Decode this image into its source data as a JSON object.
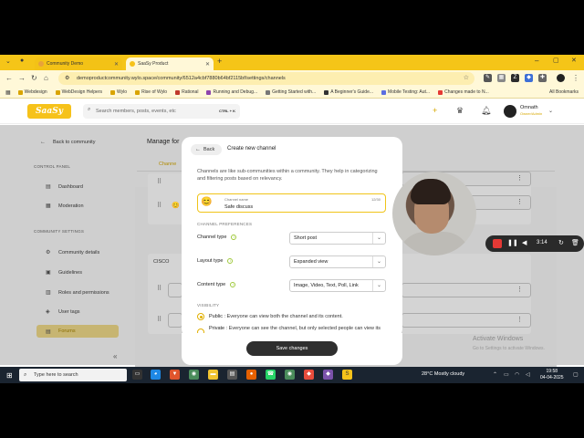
{
  "browser": {
    "tabs": [
      {
        "label": "Community Demo",
        "color": "#e8a23a"
      },
      {
        "label": "SaaSy Product",
        "color": "#f6c21a"
      }
    ],
    "url": "demoproductcommunity.wylo.space/community/6512a4cbf7880b64bf2115bf/settings/channels",
    "bookmarks": [
      "Webdesign",
      "WebDesign Helpers",
      "Wylo",
      "Rise of Wylo",
      "Rational",
      "Running and Debug...",
      "Getting Started with...",
      "A Beginner's Guide...",
      "Mobile Testing: Aut...",
      "Changes made to N..."
    ],
    "all_bookmarks": "All Bookmarks"
  },
  "app": {
    "logo": "SaaSy",
    "search_placeholder": "Search members, posts, events, etc",
    "search_shortcut": "CTRL + K",
    "user_name": "Omnath",
    "user_role": "Owner/Admin"
  },
  "sidebar": {
    "back": "Back to community",
    "control_panel": "CONTROL PANEL",
    "items_control": [
      {
        "label": "Dashboard",
        "icon": "dashboard-icon"
      },
      {
        "label": "Moderation",
        "icon": "moderation-icon"
      }
    ],
    "community_settings": "COMMUNITY SETTINGS",
    "items_settings": [
      {
        "label": "Community details",
        "icon": "details-icon"
      },
      {
        "label": "Guidelines",
        "icon": "guidelines-icon"
      },
      {
        "label": "Roles and permissions",
        "icon": "roles-icon"
      },
      {
        "label": "User tags",
        "icon": "tag-icon"
      },
      {
        "label": "Forums",
        "icon": "forum-icon"
      }
    ]
  },
  "main": {
    "title": "Manage for",
    "tab": "Channe",
    "group": "CISCO"
  },
  "modal": {
    "back": "Back",
    "title": "Create new channel",
    "description": "Channels are like sub-communities within a community. They help in categorizing and filtering posts based on relevancy.",
    "name_label": "Channel name",
    "name_value": "Safe discuss",
    "name_count": "12/30",
    "preferences": "CHANNEL PREFERENCES",
    "channel_type_label": "Channel type",
    "channel_type_value": "Short post",
    "layout_type_label": "Layout type",
    "layout_type_value": "Expanded view",
    "content_type_label": "Content type",
    "content_type_value": "Image, Video, Text, Poll, Link",
    "visibility": "VISIBILITY",
    "public_title": "Public",
    "public_desc": ": Everyone can view both the channel and its content.",
    "private_title": "Private",
    "private_desc": ": Everyone can see the channel, but only selected people can view its content.",
    "save": "Save changes"
  },
  "recorder": {
    "time": "3:14"
  },
  "watermark": {
    "line1": "Activate Windows",
    "line2": "Go to Settings to activate Windows."
  },
  "taskbar": {
    "search": "Type here to search",
    "weather": "28°C  Mostly cloudy",
    "time": "19:58",
    "date": "04-04-2025"
  }
}
